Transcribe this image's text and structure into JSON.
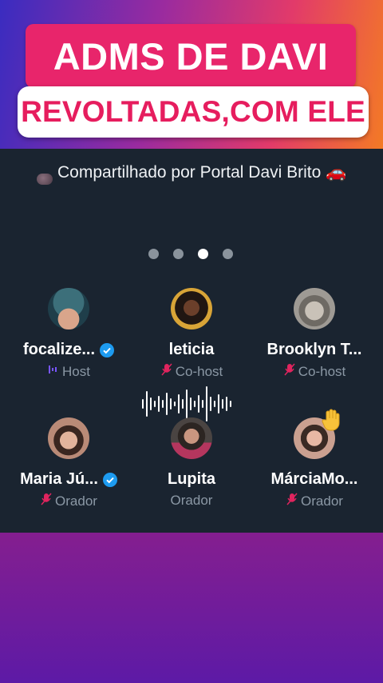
{
  "header": {
    "title": "ADMS DE DAVI",
    "subtitle": "REVOLTADAS,COM ELE"
  },
  "space": {
    "shared_by": "Compartilhado por Portal Davi Brito 🚗",
    "pagination": {
      "total": 4,
      "active": 3
    },
    "participants": [
      {
        "name": "focalize...",
        "role": "Host",
        "verified": true,
        "role_icon": "host-icon"
      },
      {
        "name": "leticia",
        "role": "Co-host",
        "verified": false,
        "role_icon": "mic-muted-icon"
      },
      {
        "name": "Brooklyn T...",
        "role": "Co-host",
        "verified": false,
        "role_icon": "mic-muted-icon"
      },
      {
        "name": "Maria Jú...",
        "role": "Orador",
        "verified": true,
        "role_icon": "mic-muted-icon"
      },
      {
        "name": "Lupita",
        "role": "Orador",
        "verified": false,
        "role_icon": ""
      },
      {
        "name": "MárciaMo...",
        "role": "Orador",
        "verified": false,
        "role_icon": "mic-muted-icon"
      }
    ]
  },
  "colors": {
    "accent_pink": "#e8256b",
    "panel": "#1a2430",
    "verified_blue": "#1d9bf0",
    "muted_role": "#8b98a5",
    "mic_muted": "#e0245e"
  }
}
